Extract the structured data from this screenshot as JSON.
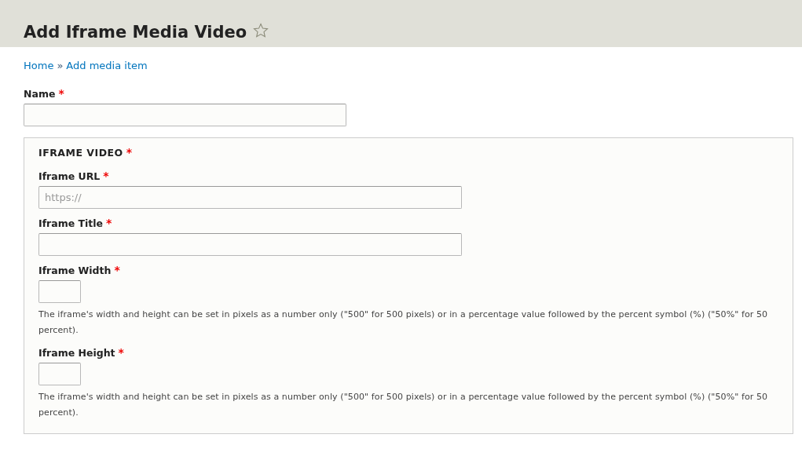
{
  "header": {
    "title": "Add Iframe Media Video",
    "favorite": false
  },
  "breadcrumb": [
    {
      "label": "Home"
    },
    {
      "label": "»",
      "kind": "separator"
    },
    {
      "label": "Add media item"
    }
  ],
  "name_field": {
    "label": "Name",
    "required_mark": "*"
  },
  "fieldset": {
    "legend": "IFRAME VIDEO",
    "required_mark": "*",
    "fields": [
      {
        "kind": "wide",
        "label": "Iframe URL",
        "required_mark": "*",
        "placeholder": "https://"
      },
      {
        "kind": "wide",
        "label": "Iframe Title",
        "required_mark": "*"
      },
      {
        "kind": "small",
        "label": "Iframe Width",
        "required_mark": "*",
        "description": "The iframe's width and height can be set in pixels as a number only (\"500\" for 500 pixels) or in a percentage value followed by the percent symbol (%) (\"50%\" for 50 percent)."
      },
      {
        "kind": "small",
        "label": "Iframe Height",
        "required_mark": "*",
        "description": "The iframe's width and height can be set in pixels as a number only (\"500\" for 500 pixels) or in a percentage value followed by the percent symbol (%) (\"50%\" for 50 percent)."
      }
    ]
  }
}
